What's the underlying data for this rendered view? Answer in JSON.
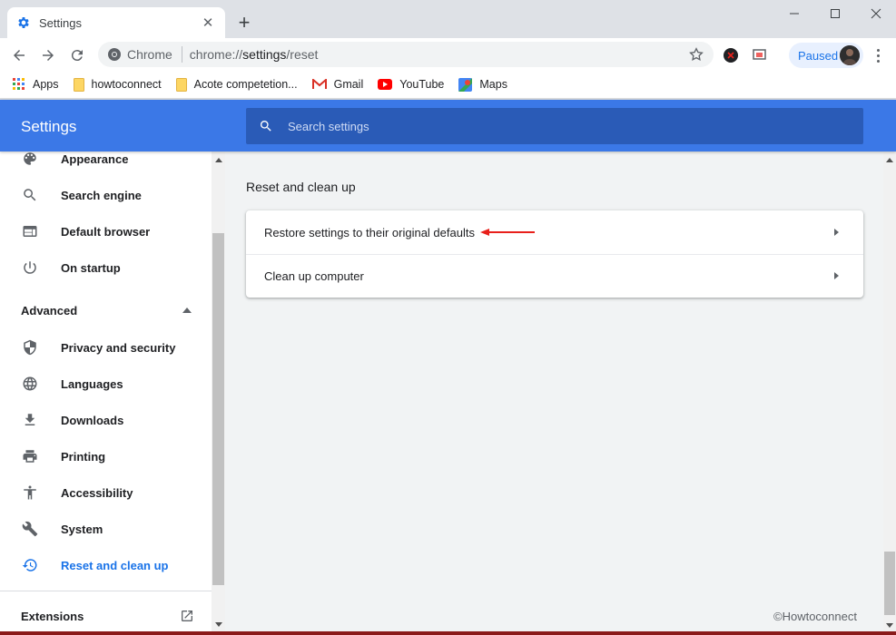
{
  "tab": {
    "title": "Settings"
  },
  "toolbar": {
    "site_chip": "Chrome",
    "url_scheme": "chrome://",
    "url_host": "settings",
    "url_path": "/reset",
    "paused_label": "Paused"
  },
  "bookmarks": [
    {
      "label": "Apps",
      "icon": "apps-grid-icon"
    },
    {
      "label": "howtoconnect",
      "icon": "folder-icon"
    },
    {
      "label": "Acote competetion...",
      "icon": "folder-icon"
    },
    {
      "label": "Gmail",
      "icon": "gmail-icon"
    },
    {
      "label": "YouTube",
      "icon": "youtube-icon"
    },
    {
      "label": "Maps",
      "icon": "maps-icon"
    }
  ],
  "header": {
    "title": "Settings",
    "search_placeholder": "Search settings"
  },
  "sidebar": {
    "items": [
      {
        "label": "Appearance",
        "icon": "palette-icon"
      },
      {
        "label": "Search engine",
        "icon": "search-icon"
      },
      {
        "label": "Default browser",
        "icon": "browser-window-icon"
      },
      {
        "label": "On startup",
        "icon": "power-icon"
      }
    ],
    "advanced_label": "Advanced",
    "advanced_items": [
      {
        "label": "Privacy and security",
        "icon": "shield-icon"
      },
      {
        "label": "Languages",
        "icon": "globe-icon"
      },
      {
        "label": "Downloads",
        "icon": "download-icon"
      },
      {
        "label": "Printing",
        "icon": "printer-icon"
      },
      {
        "label": "Accessibility",
        "icon": "accessibility-icon"
      },
      {
        "label": "System",
        "icon": "wrench-icon"
      },
      {
        "label": "Reset and clean up",
        "icon": "restore-clock-icon",
        "active": true
      }
    ],
    "extensions_label": "Extensions"
  },
  "main": {
    "section_heading": "Reset and clean up",
    "rows": [
      {
        "label": "Restore settings to their original defaults"
      },
      {
        "label": "Clean up computer"
      }
    ]
  },
  "watermark": "©Howtoconnect",
  "colors": {
    "header_blue": "#3b78e7",
    "search_blue": "#2a5bb7",
    "active_blue": "#1a73e8",
    "annotation_red": "#e8201b"
  }
}
